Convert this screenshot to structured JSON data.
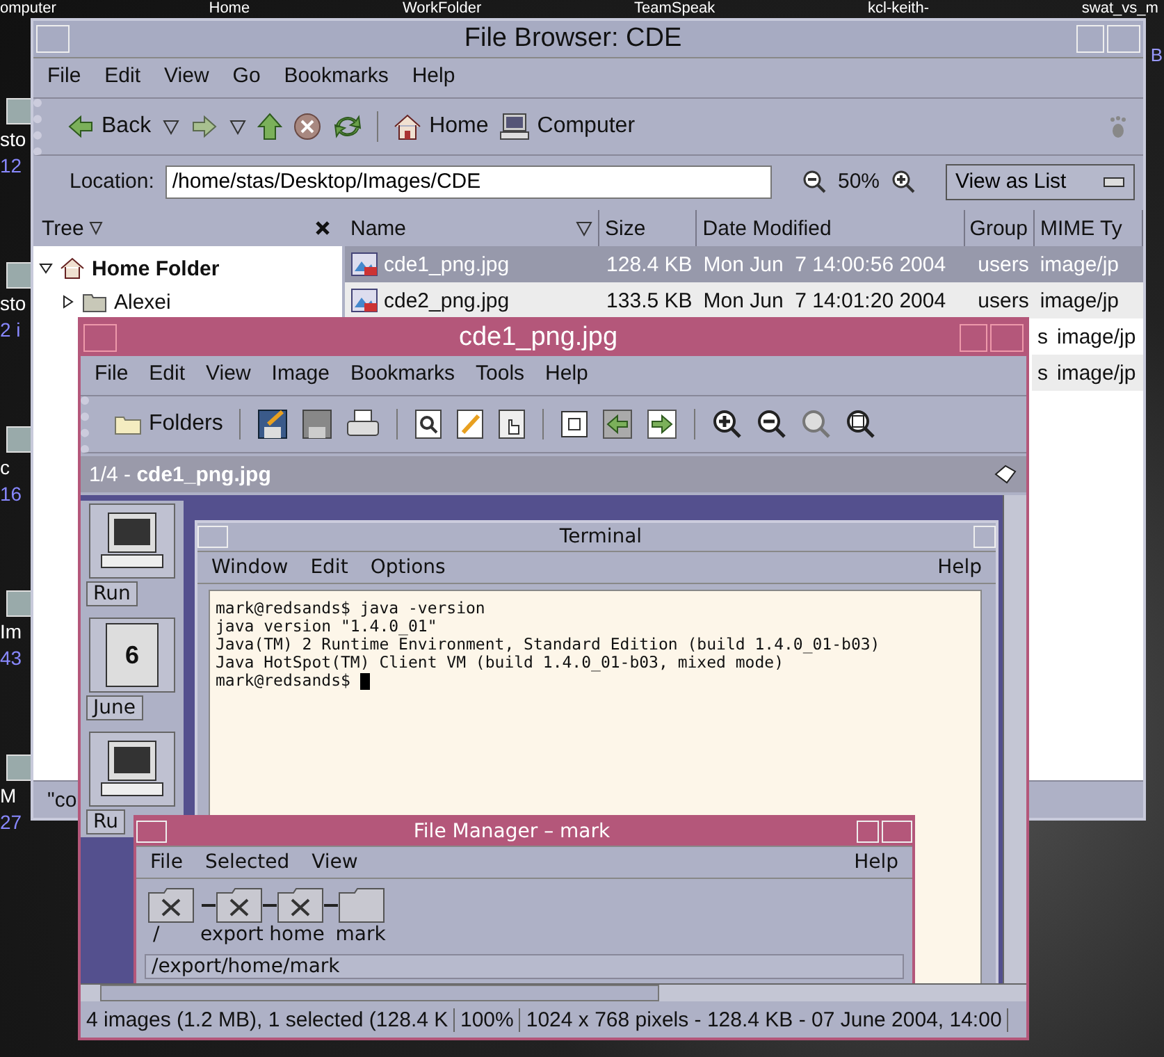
{
  "desktop": {
    "top_labels": [
      "omputer",
      "Home",
      "WorkFolder",
      "TeamSpeak",
      "kcl-keith-",
      "swat_vs_m"
    ],
    "side_icons": [
      {
        "name": "sto",
        "sub": "12"
      },
      {
        "name": "sto",
        "sub": "2 i"
      },
      {
        "name": "c",
        "sub": "16"
      },
      {
        "name": "Im",
        "sub": "43"
      },
      {
        "name": "M",
        "sub": "27"
      }
    ],
    "right_label": "B"
  },
  "file_browser": {
    "title": "File Browser: CDE",
    "menu": [
      "File",
      "Edit",
      "View",
      "Go",
      "Bookmarks",
      "Help"
    ],
    "toolbar": [
      {
        "kind": "back",
        "label": "Back"
      },
      {
        "kind": "dropdown"
      },
      {
        "kind": "forward"
      },
      {
        "kind": "dropdown"
      },
      {
        "kind": "up"
      },
      {
        "kind": "stop"
      },
      {
        "kind": "reload"
      },
      {
        "kind": "separator"
      },
      {
        "kind": "home",
        "label": "Home"
      },
      {
        "kind": "computer",
        "label": "Computer"
      }
    ],
    "location": {
      "label": "Location:",
      "value": "/home/stas/Desktop/Images/CDE"
    },
    "zoom": "50%",
    "view_mode": "View as List",
    "tree": {
      "title": "Tree",
      "items": [
        {
          "label": "Home Folder",
          "expanded": true,
          "children": [
            {
              "label": "Alexei",
              "expanded": false
            }
          ]
        }
      ]
    },
    "table": {
      "columns": [
        "Name",
        "Size",
        "Date Modified",
        "Group",
        "MIME Ty"
      ],
      "rows": [
        {
          "name": "cde1_png.jpg",
          "size": "128.4 KB",
          "date": "Mon Jun  7 14:00:56 2004",
          "group": "users",
          "mime": "image/jp",
          "selected": true
        },
        {
          "name": "cde2_png.jpg",
          "size": "133.5 KB",
          "date": "Mon Jun  7 14:01:20 2004",
          "group": "users",
          "mime": "image/jp",
          "selected": false
        },
        {
          "group": "s",
          "mime": "image/jp",
          "selected": false
        },
        {
          "group": "s",
          "mime": "image/jp",
          "selected": false
        }
      ]
    },
    "status": "\"co"
  },
  "image_viewer": {
    "title": "cde1_png.jpg",
    "menu": [
      "File",
      "Edit",
      "View",
      "Image",
      "Bookmarks",
      "Tools",
      "Help"
    ],
    "folders_label": "Folders",
    "info": "1/4 - **cde1_png.jpg**",
    "screenshot": {
      "front_panel": [
        {
          "kind": "monitor",
          "label": "Run"
        },
        {
          "kind": "calendar",
          "day": "6",
          "label": "June"
        },
        {
          "kind": "monitor",
          "label": "Ru"
        }
      ],
      "terminal": {
        "title": "Terminal",
        "menu": [
          "Window",
          "Edit",
          "Options"
        ],
        "help": "Help",
        "lines": [
          "mark@redsands$ java -version",
          "java version \"1.4.0_01\"",
          "Java(TM) 2 Runtime Environment, Standard Edition (build 1.4.0_01-b03)",
          "Java HotSpot(TM) Client VM (build 1.4.0_01-b03, mixed mode)",
          "mark@redsands$ "
        ]
      },
      "file_manager": {
        "title": "File Manager – mark",
        "menu": [
          "File",
          "Selected",
          "View"
        ],
        "help": "Help",
        "path_items": [
          {
            "label": "/",
            "current": false
          },
          {
            "label": "export",
            "current": false
          },
          {
            "label": "home",
            "current": false
          },
          {
            "label": "mark",
            "current": true
          }
        ],
        "path": "/export/home/mark"
      }
    },
    "status": [
      "4 images (1.2 MB), 1 selected (128.4 K",
      "100%",
      "1024 x 768 pixels - 128.4 KB - 07 June 2004, 14:00"
    ]
  }
}
